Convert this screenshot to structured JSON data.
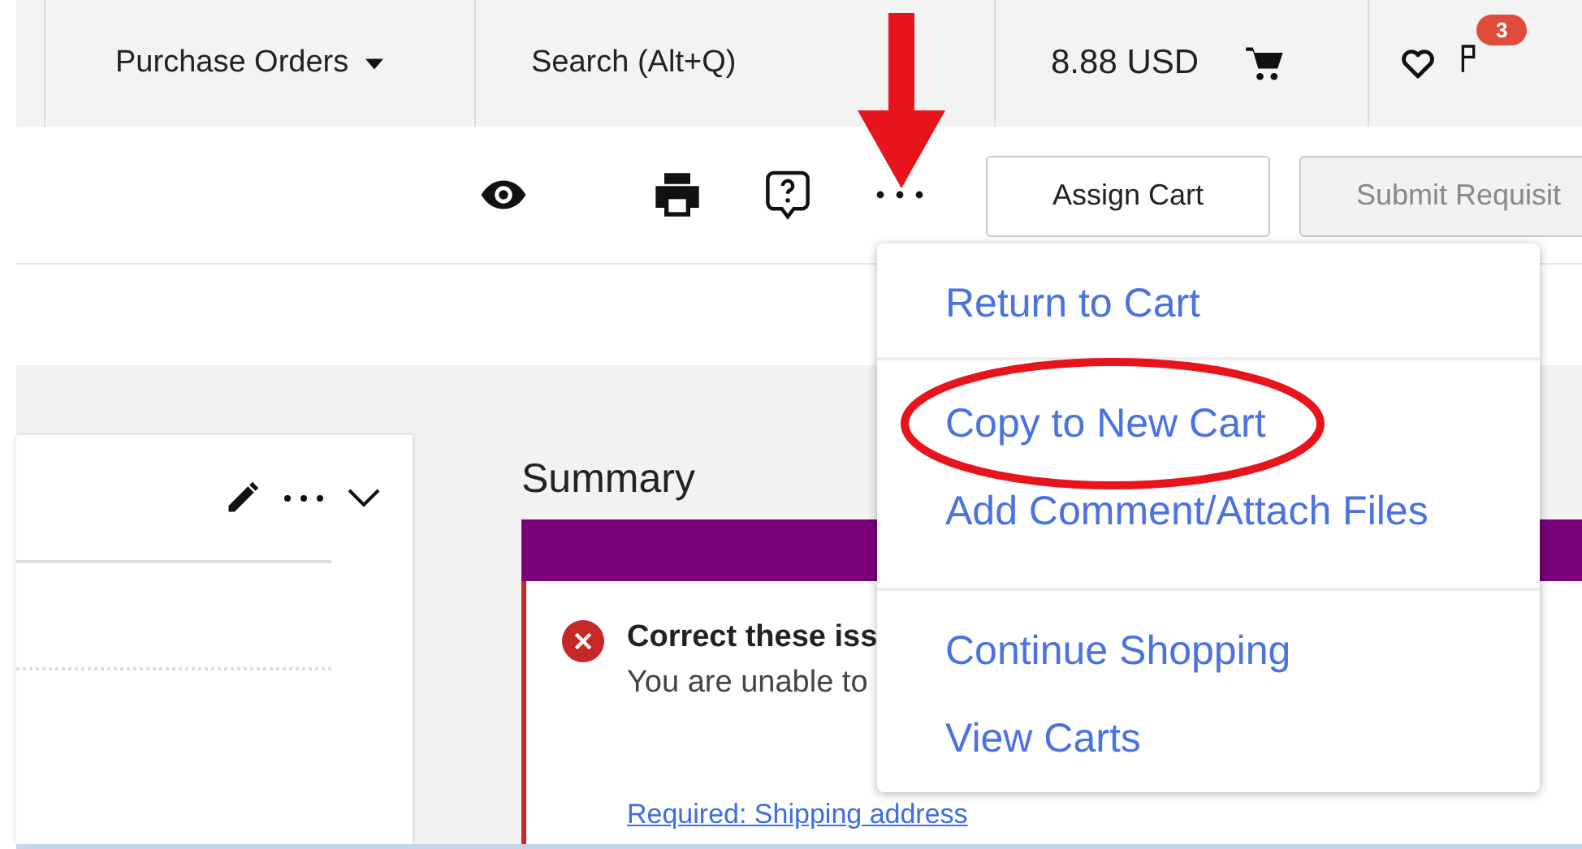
{
  "top_bar": {
    "nav_menu": {
      "label": "Purchase Orders"
    },
    "search": {
      "label": "Search (Alt+Q)"
    },
    "cart_total": "8.88 USD",
    "notifications_badge": "3"
  },
  "toolbar": {
    "buttons": [
      {
        "label": "Assign Cart",
        "disabled": false
      },
      {
        "label": "Submit Requisit",
        "disabled": true
      }
    ]
  },
  "summary": {
    "title": "Summary",
    "error_title": "Correct these iss",
    "error_text": "You are unable to",
    "link": "Required: Shipping address"
  },
  "menu": {
    "groups": [
      [
        {
          "label": "Return to Cart",
          "circled": false
        }
      ],
      [
        {
          "label": "Copy to New Cart",
          "circled": true
        },
        {
          "label": "Add Comment/Attach Files",
          "circled": false
        }
      ],
      [
        {
          "label": "Continue Shopping",
          "circled": false
        },
        {
          "label": "View Carts",
          "circled": false
        }
      ]
    ]
  }
}
